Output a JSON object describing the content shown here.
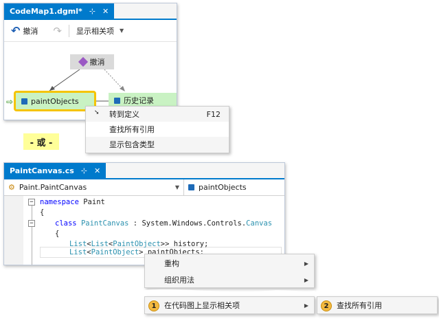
{
  "codemap": {
    "tab_title": "CodeMap1.dgml*",
    "pin_glyph": "⊹",
    "close_glyph": "✕",
    "toolbar": {
      "undo_label": "撤消",
      "related_label": "显示相关项"
    },
    "nodes": {
      "undo": "撤消",
      "paint_objects": "paintObjects",
      "history": "历史记录"
    }
  },
  "context_menu_1": {
    "items": [
      {
        "label": "转到定义",
        "shortcut": "F12"
      },
      {
        "label": "查找所有引用"
      },
      {
        "label": "显示包含类型"
      }
    ]
  },
  "or_label": "- 或 -",
  "editor": {
    "tab_title": "PaintCanvas.cs",
    "pin_glyph": "⊹",
    "close_glyph": "✕",
    "nav_left": "Paint.PaintCanvas",
    "nav_right": "paintObjects",
    "code": {
      "l1_kw": "namespace",
      "l1_rest": " Paint",
      "l2": "{",
      "l3_kw": "class",
      "l3_type": "PaintCanvas",
      "l3_mid": " : System.Windows.Controls.",
      "l3_type2": "Canvas",
      "l4": "{",
      "l5_a": "List",
      "l5_b": "<",
      "l5_c": "List",
      "l5_d": "<",
      "l5_e": "PaintObject",
      "l5_f": ">> history;",
      "l6_a": "List",
      "l6_b": "<",
      "l6_c": "PaintObject",
      "l6_d": "> ",
      "l6_e": "paintObjects;"
    }
  },
  "context_menu_2": {
    "items": [
      {
        "label": "重构"
      },
      {
        "label": "组织用法"
      }
    ],
    "show_on_map": {
      "callout": "1",
      "label": "在代码图上显示相关项"
    }
  },
  "submenu": {
    "callout": "2",
    "label": "查找所有引用"
  },
  "colors": {
    "accent": "#007acc",
    "node_green": "#c9f2c3",
    "selection": "#f5c400",
    "highlight_label": "#ffff99"
  }
}
